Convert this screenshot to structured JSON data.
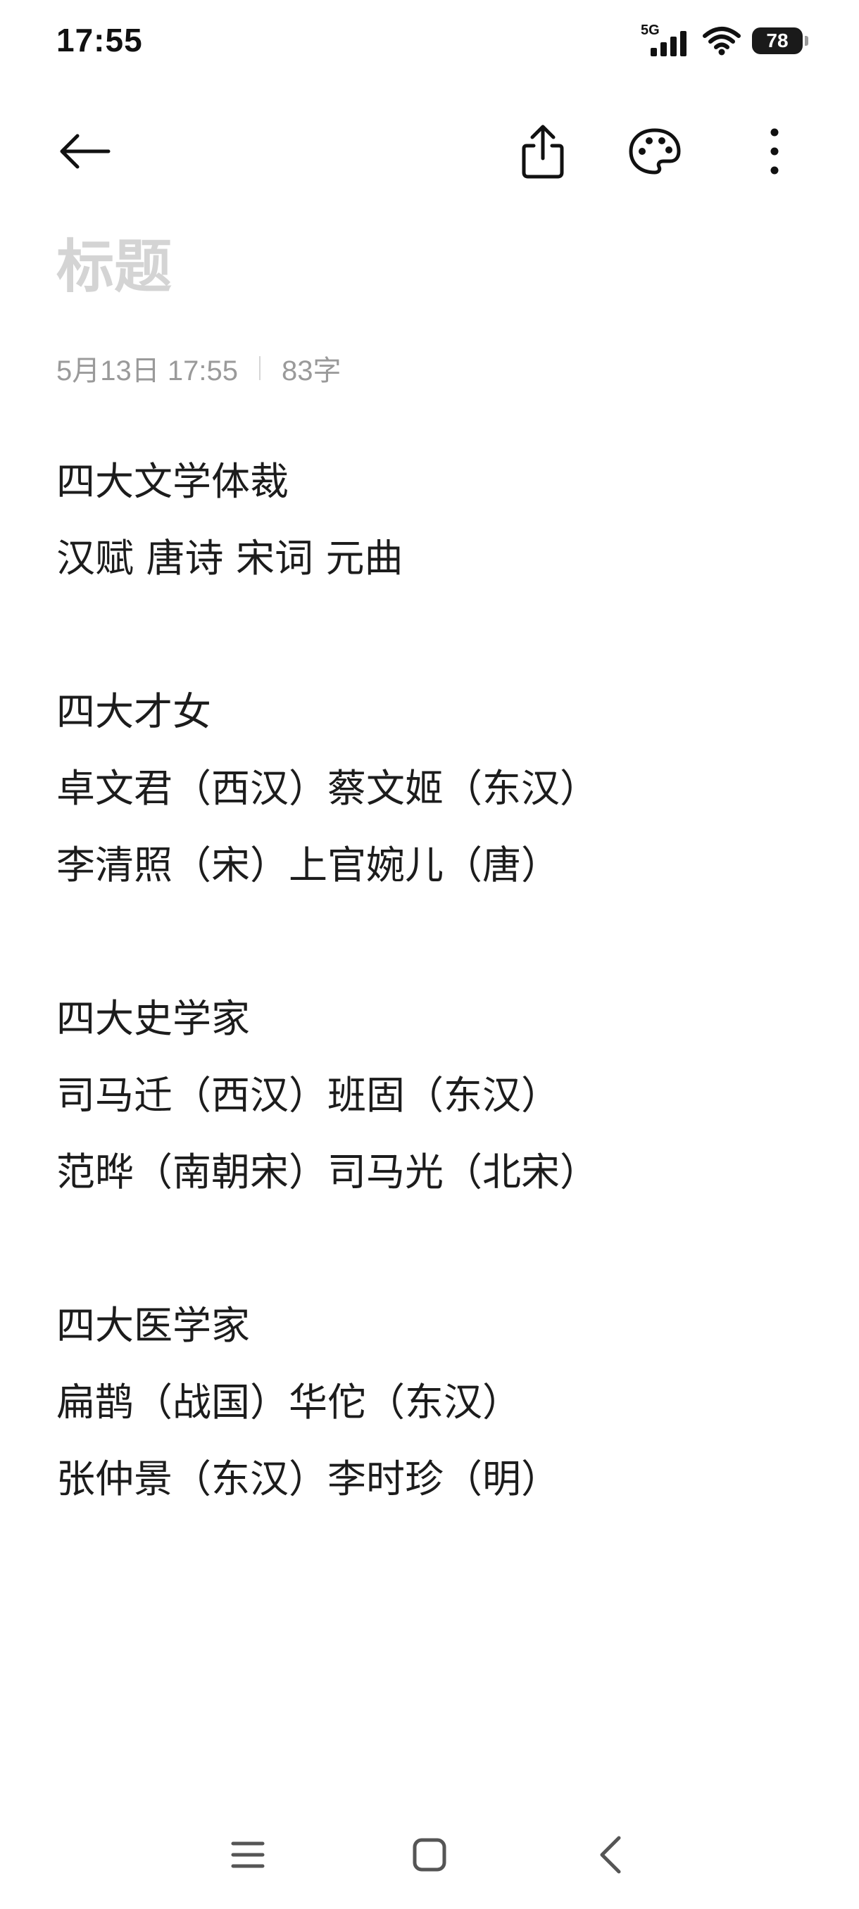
{
  "status_bar": {
    "time": "17:55",
    "network": "5G",
    "battery": "78"
  },
  "toolbar": {
    "back_icon": "arrow-left-icon",
    "share_icon": "share-icon",
    "theme_icon": "palette-icon",
    "more_icon": "more-vertical-icon"
  },
  "note": {
    "title_placeholder": "标题",
    "date": "5月13日 17:55",
    "word_count": "83字",
    "lines": [
      "四大文学体裁",
      "汉赋 唐诗 宋词 元曲",
      "",
      "四大才女",
      "卓文君（西汉）蔡文姬（东汉）",
      "李清照（宋）上官婉儿（唐）",
      "",
      "四大史学家",
      "司马迁（西汉）班固（东汉）",
      "范晔（南朝宋）司马光（北宋）",
      "",
      "四大医学家",
      "扁鹊（战国）华佗（东汉）",
      "张仲景（东汉）李时珍（明）"
    ]
  },
  "nav_bar": {
    "menu_icon": "menu-icon",
    "home_icon": "home-square-icon",
    "back_icon": "back-chevron-icon"
  }
}
